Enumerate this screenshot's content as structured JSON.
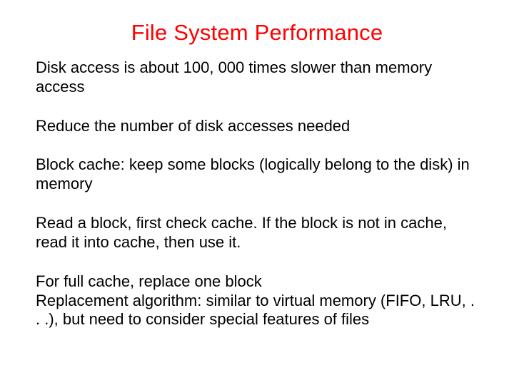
{
  "slide": {
    "title": "File System Performance",
    "paragraphs": [
      "Disk access is about 100, 000 times slower than memory access",
      "Reduce the number of disk accesses needed",
      "Block cache: keep some blocks (logically belong to the disk) in memory",
      "Read a block, first check cache. If the block is not in cache, read it into cache, then use it.",
      "For full cache, replace one block\nReplacement algorithm: similar to virtual memory (FIFO, LRU, . . .), but need to consider special features of files"
    ]
  }
}
